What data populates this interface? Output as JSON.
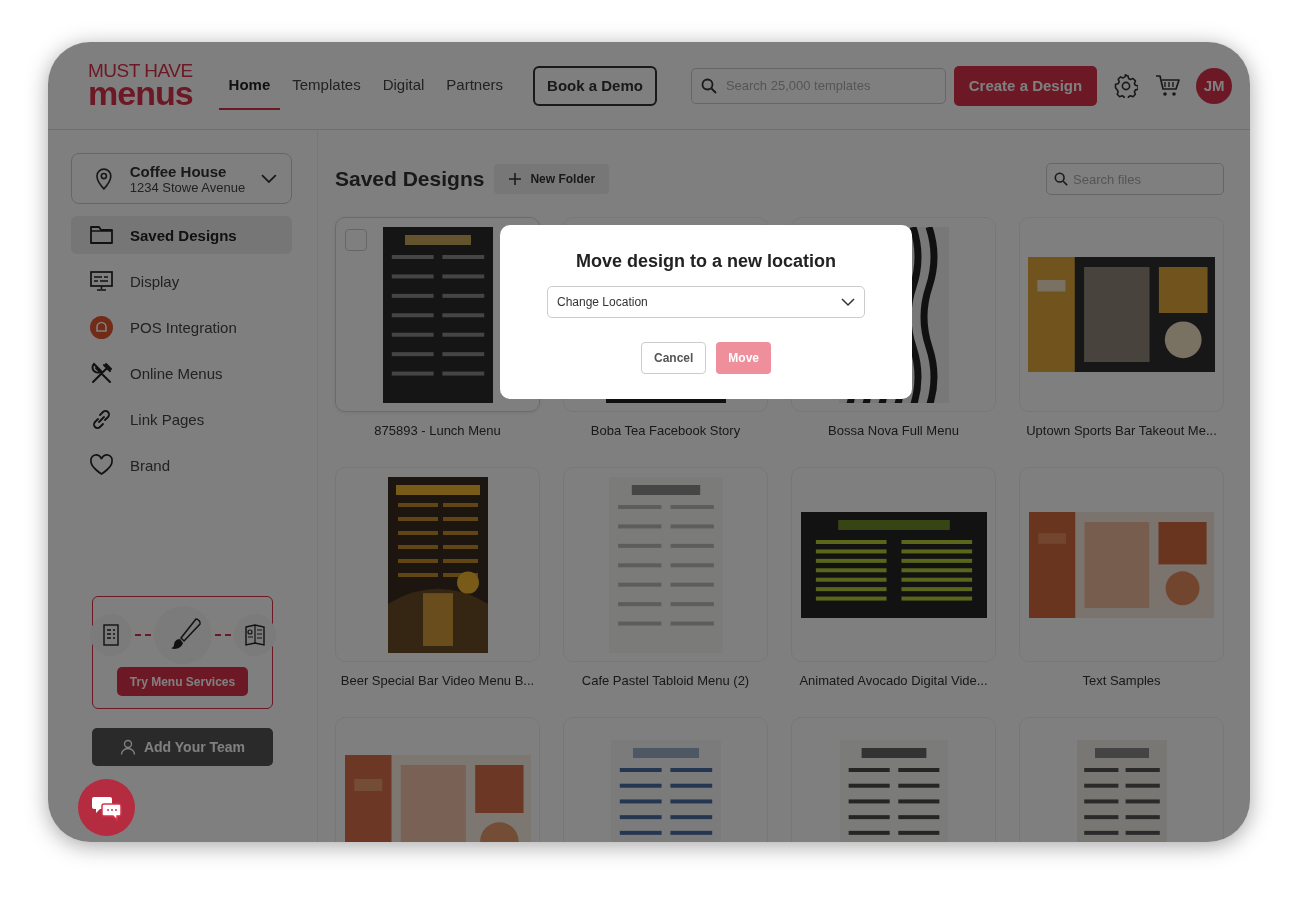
{
  "logo": {
    "line_1": "MUST HAVE",
    "line_2": "menus"
  },
  "nav": [
    {
      "label": "Home",
      "selected": true
    },
    {
      "label": "Templates",
      "selected": false
    },
    {
      "label": "Digital",
      "selected": false
    },
    {
      "label": "Partners",
      "selected": false
    }
  ],
  "demo_button": "Book a Demo",
  "search": {
    "placeholder": "Search 25,000 templates"
  },
  "create_button": "Create a Design",
  "avatar": "JM",
  "location": {
    "name": "Coffee House",
    "address": "1234 Stowe Avenue"
  },
  "sidebar": {
    "items": [
      {
        "label": "Saved Designs",
        "kind": "folder",
        "selected": true
      },
      {
        "label": "Display",
        "kind": "monitor",
        "selected": false
      },
      {
        "label": "POS Integration",
        "kind": "pos",
        "selected": false
      },
      {
        "label": "Online Menus",
        "kind": "utensils",
        "selected": false
      },
      {
        "label": "Link Pages",
        "kind": "link",
        "selected": false
      },
      {
        "label": "Brand",
        "kind": "heart",
        "selected": false
      }
    ]
  },
  "services": {
    "button": "Try Menu Services"
  },
  "team_button": "Add Your Team",
  "content": {
    "title": "Saved Designs",
    "new_folder": "New Folder",
    "search": {
      "placeholder": "Search files"
    },
    "designs": [
      {
        "title": "875893 - Lunch Menu",
        "hovered": true
      },
      {
        "title": "Boba Tea Facebook Story",
        "hovered": false
      },
      {
        "title": "Bossa Nova Full Menu",
        "hovered": false
      },
      {
        "title": "Uptown Sports Bar Takeout Me...",
        "hovered": false
      },
      {
        "title": "Beer Special Bar Video Menu B...",
        "hovered": false
      },
      {
        "title": "Cafe Pastel Tabloid Menu (2)",
        "hovered": false
      },
      {
        "title": "Animated Avocado Digital Vide...",
        "hovered": false
      },
      {
        "title": "Text Samples",
        "hovered": false
      },
      {
        "hovered": false
      },
      {
        "hovered": false
      },
      {
        "hovered": false
      },
      {
        "hovered": false
      }
    ]
  },
  "modal": {
    "title": "Move design to a new location",
    "select": "Change Location",
    "cancel_button": "Cancel",
    "move_button": {
      "label": "Move",
      "disabled": true
    }
  }
}
